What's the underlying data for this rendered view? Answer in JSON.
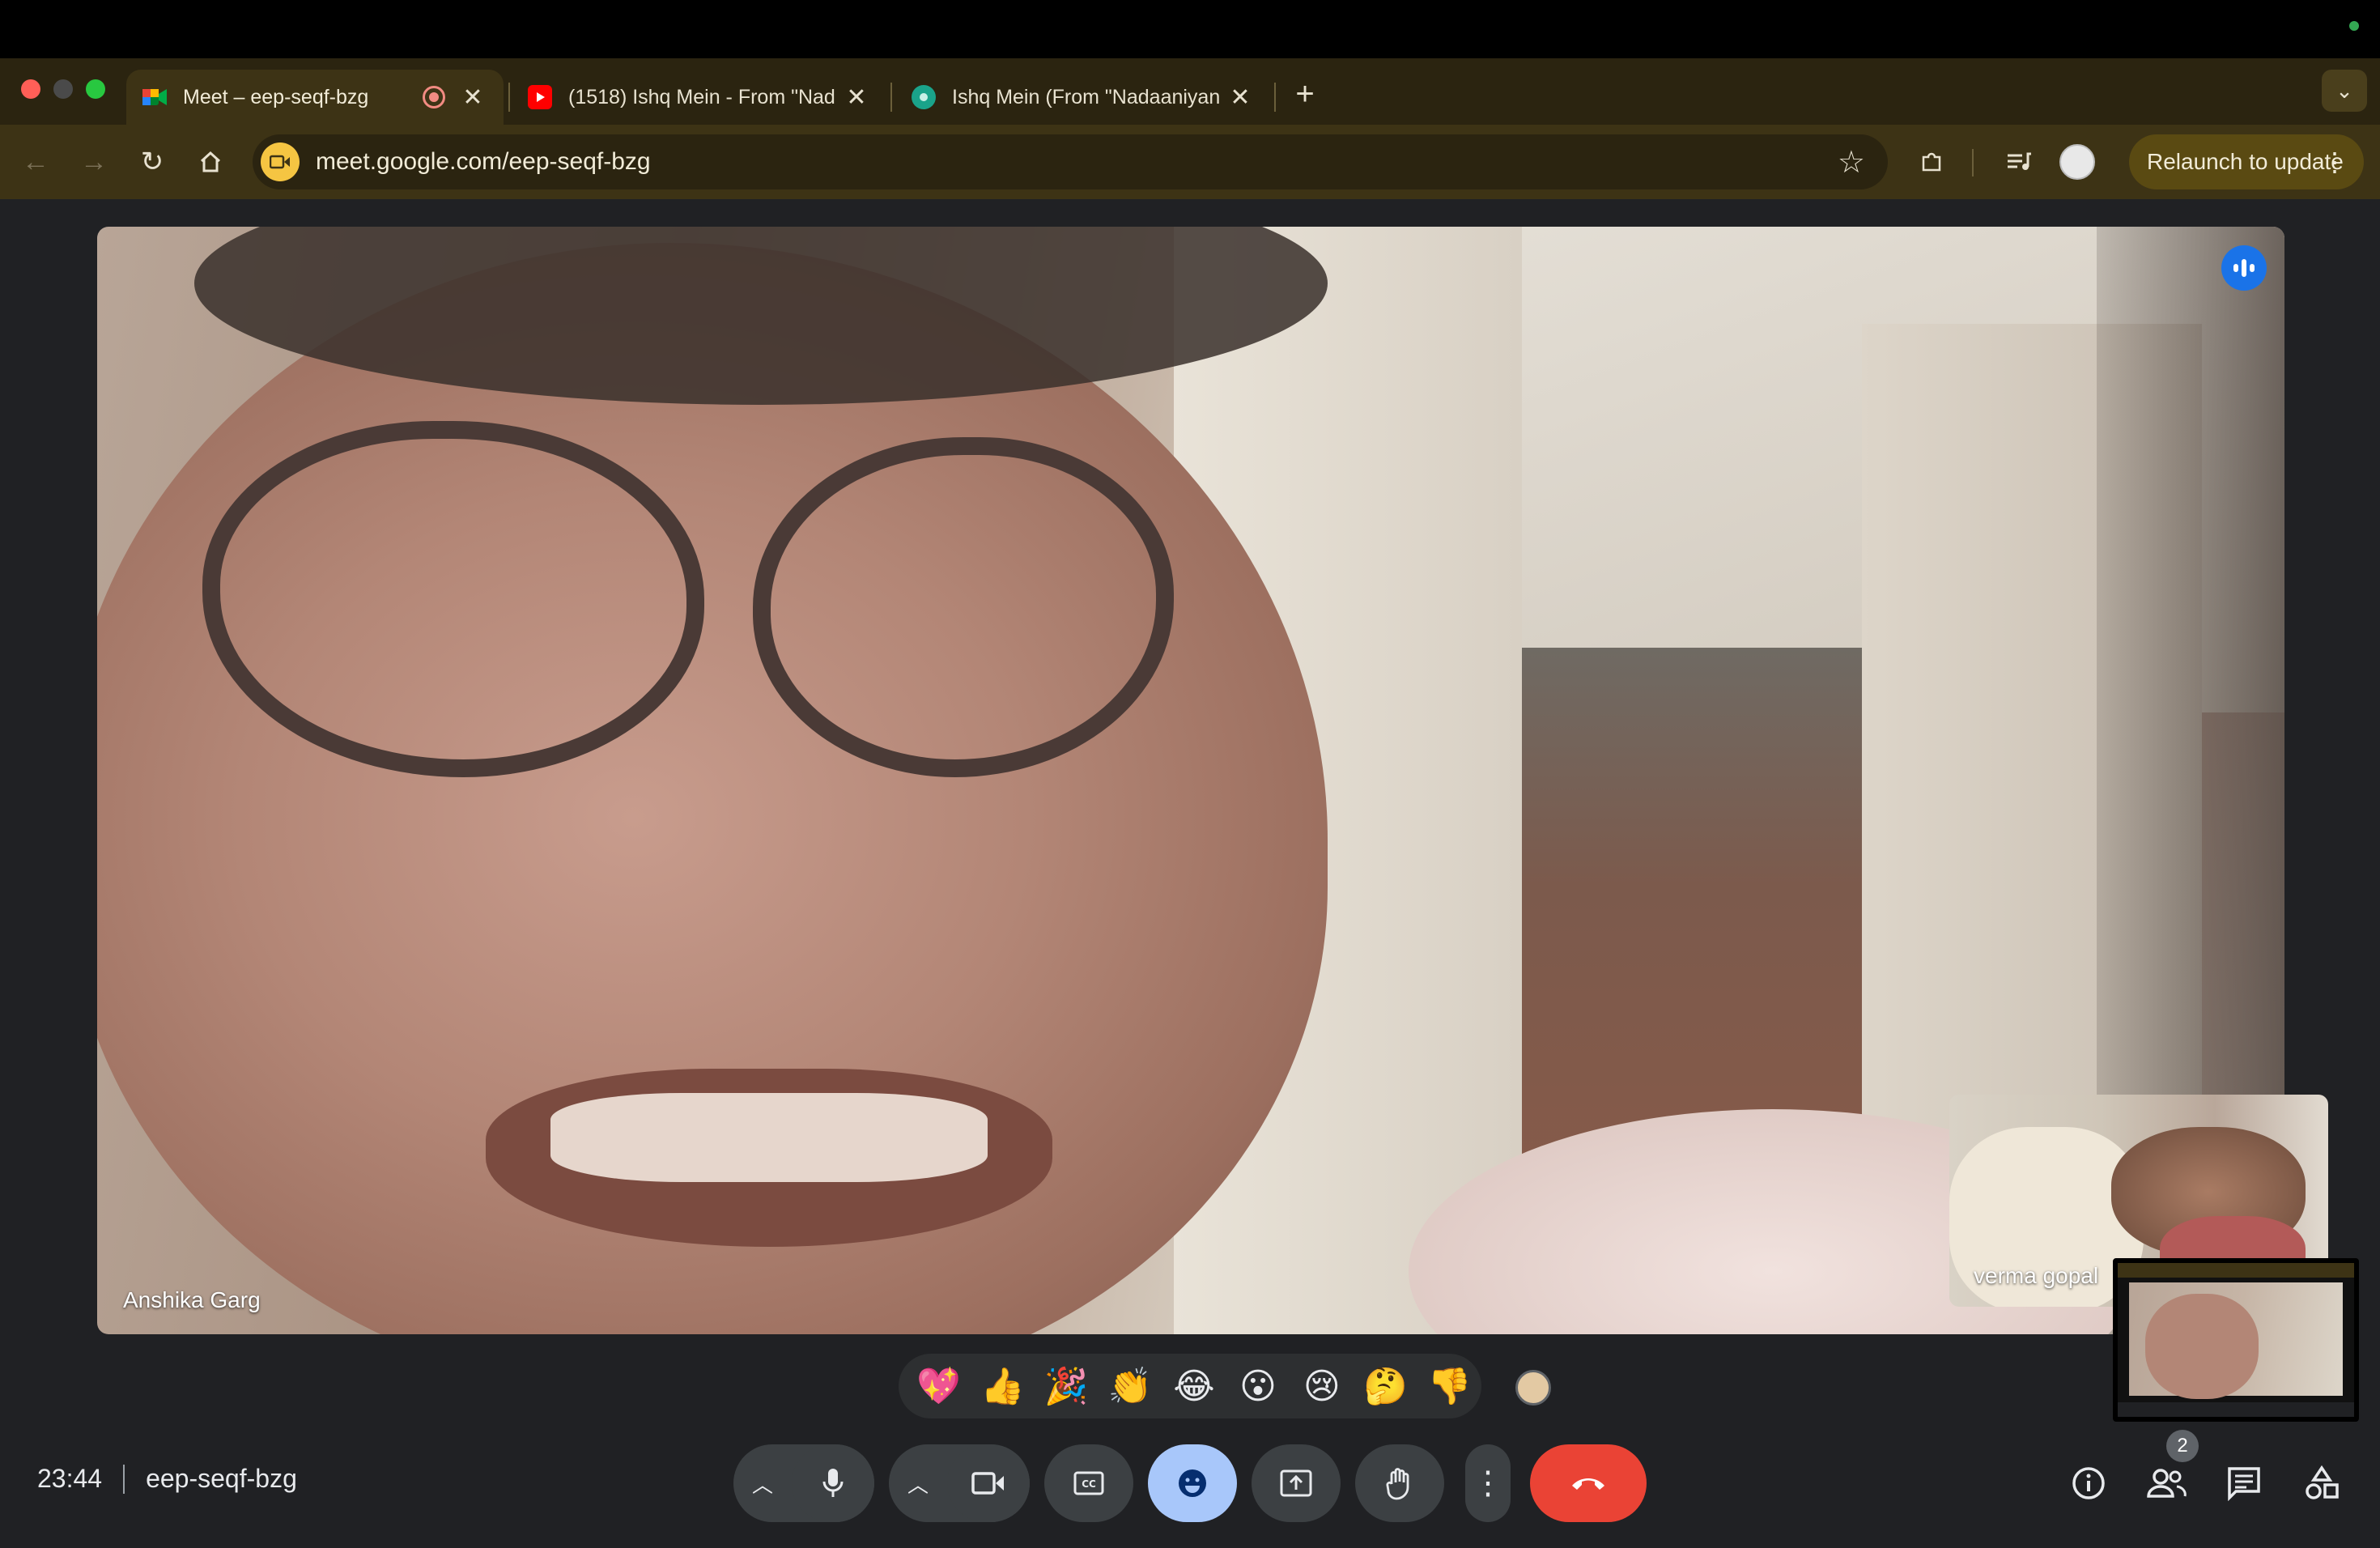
{
  "browser": {
    "tabs": [
      {
        "title": "Meet – eep-seqf-bzg",
        "active": true,
        "favicon": "google-meet-icon",
        "recording": true
      },
      {
        "title": "(1518) Ishq Mein - From \"Nad",
        "active": false,
        "favicon": "youtube-icon"
      },
      {
        "title": "Ishq Mein (From \"Nadaaniyan",
        "active": false,
        "favicon": "lyrics-site-icon"
      }
    ],
    "url": "meet.google.com/eep-seqf-bzg",
    "relaunch_label": "Relaunch to update"
  },
  "meeting": {
    "time": "23:44",
    "code": "eep-seqf-bzg",
    "participant_count": "2",
    "main_participant": "Anshika Garg",
    "pip_participant": "verma gopal"
  },
  "reactions": [
    "💖",
    "👍",
    "🎉",
    "👏",
    "😂",
    "😮",
    "😢",
    "🤔",
    "👎"
  ],
  "colors": {
    "tab_bar": "#2b2410",
    "toolbar": "#3d3315",
    "meet_bg": "#202124",
    "end_call": "#ea4335",
    "reaction_active": "#a8c7fa"
  }
}
